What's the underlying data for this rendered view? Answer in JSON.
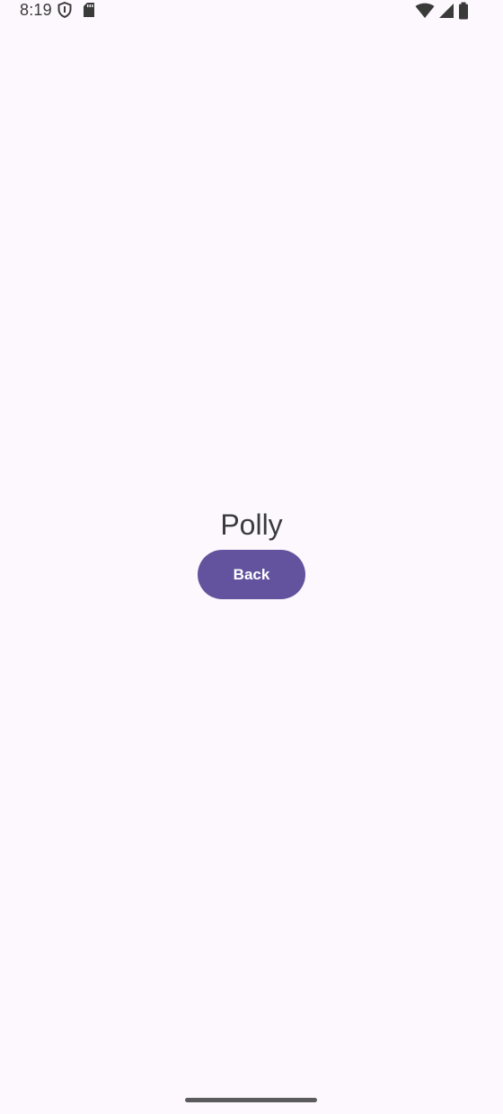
{
  "status_bar": {
    "time": "8:19",
    "left_icons": [
      "shield-icon",
      "sd-card-icon"
    ],
    "right_icons": [
      "wifi-icon",
      "cellular-signal-icon",
      "battery-icon"
    ]
  },
  "main": {
    "title": "Polly",
    "back_label": "Back"
  },
  "colors": {
    "background": "#fdf8fd",
    "button": "#63539e",
    "button_text": "#ffffff",
    "title_text": "#3b3b3f"
  }
}
